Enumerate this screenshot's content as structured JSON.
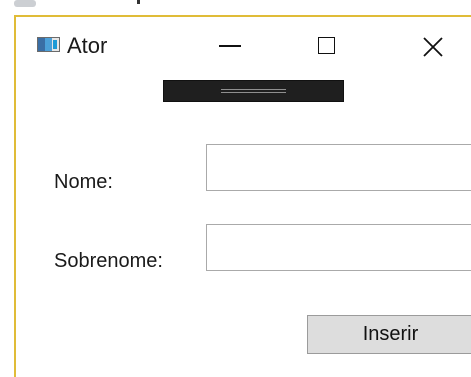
{
  "window": {
    "title": "Ator",
    "accent_border_color": "#e0bc38",
    "icons": {
      "app": "window-app-icon",
      "minimize": "minimize-icon",
      "maximize": "maximize-icon",
      "close": "close-icon"
    }
  },
  "overlay": {
    "icon": "drag-handle-icon"
  },
  "form": {
    "fields": [
      {
        "label": "Nome:",
        "value": "",
        "placeholder": ""
      },
      {
        "label": "Sobrenome:",
        "value": "",
        "placeholder": ""
      }
    ],
    "submit_label": "Inserir"
  }
}
